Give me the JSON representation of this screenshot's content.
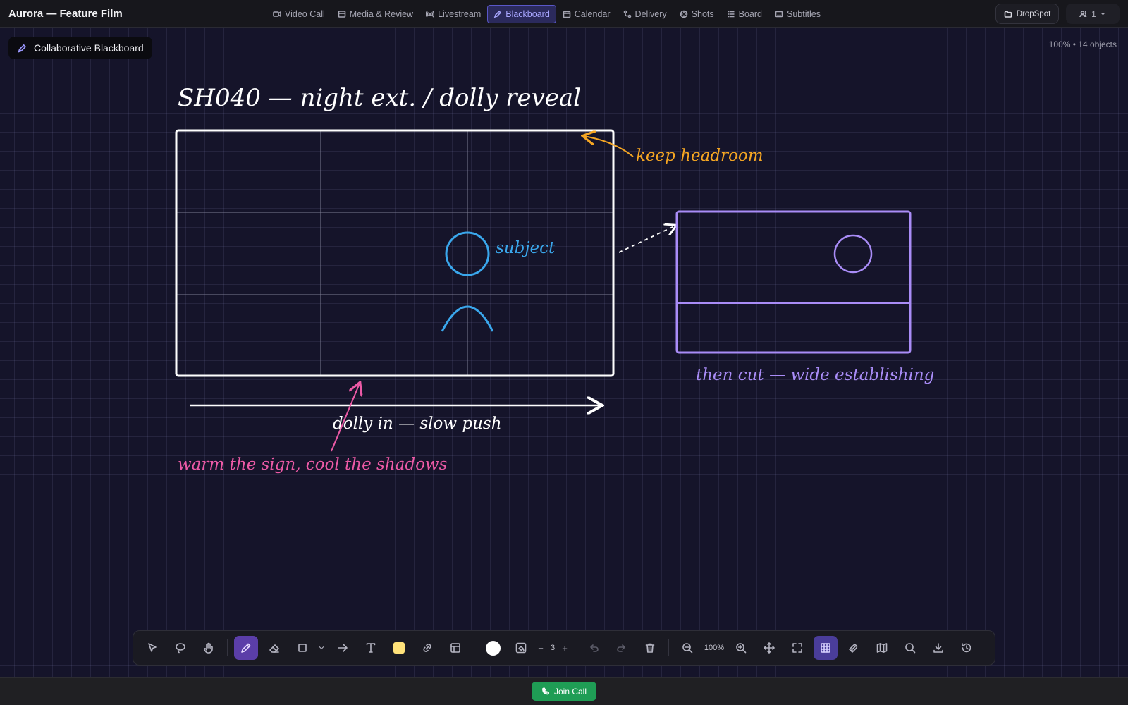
{
  "app": {
    "title": "Aurora — Feature Film"
  },
  "tabs": [
    {
      "label": "Video Call",
      "icon": "video-icon"
    },
    {
      "label": "Media & Review",
      "icon": "media-icon"
    },
    {
      "label": "Livestream",
      "icon": "broadcast-icon"
    },
    {
      "label": "Blackboard",
      "icon": "pen-icon",
      "active": true
    },
    {
      "label": "Calendar",
      "icon": "calendar-icon"
    },
    {
      "label": "Delivery",
      "icon": "delivery-icon"
    },
    {
      "label": "Shots",
      "icon": "shots-icon"
    },
    {
      "label": "Board",
      "icon": "board-icon"
    },
    {
      "label": "Subtitles",
      "icon": "subtitles-icon"
    }
  ],
  "header_right": {
    "dropspot_label": "DropSpot",
    "user_count": "1"
  },
  "canvas": {
    "board_label": "Collaborative Blackboard",
    "zoom_info": "100% • 14 objects"
  },
  "drawing": {
    "title": "SH040 — night ext. / dolly reveal",
    "note_headroom": "keep headroom",
    "note_subject": "subject",
    "note_dolly": "dolly in — slow push",
    "note_warm": "warm the sign, cool the shadows",
    "note_cut": "then cut — wide establishing",
    "colors": {
      "white": "#ffffff",
      "orange": "#f5a623",
      "blue": "#3aa7ec",
      "pink": "#ec5aa6",
      "purple": "#a98cf7",
      "grid_line": "#7c7c92"
    }
  },
  "toolbar": {
    "stroke_value": "3",
    "zoom_value": "100%",
    "accent": "#5b3ea8",
    "fill_color": "#ffe27a",
    "stroke_color": "#ffffff"
  },
  "bottom": {
    "join_label": "Join Call",
    "join_color": "#1f9d55"
  }
}
